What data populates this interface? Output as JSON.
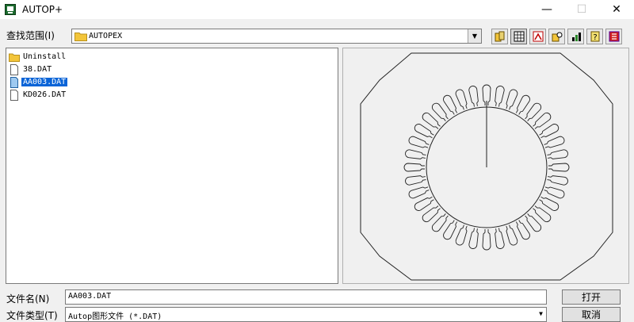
{
  "window": {
    "title": "AUTOP+",
    "minimize_symbol": "—",
    "maximize_symbol": "☐",
    "close_symbol": "✕"
  },
  "lookin": {
    "label": "查找范围(I)",
    "value": "AUTOPEX",
    "icon": "folder-icon"
  },
  "toolbar": {
    "buttons": [
      "folder-open-icon",
      "grid-icon",
      "chart-icon",
      "search-folder-icon",
      "bars-icon",
      "help-icon",
      "exit-icon"
    ]
  },
  "files": [
    {
      "name": "Uninstall",
      "type": "folder",
      "selected": false
    },
    {
      "name": "38.DAT",
      "type": "file",
      "selected": false
    },
    {
      "name": "AA003.DAT",
      "type": "file",
      "selected": true
    },
    {
      "name": "KD026.DAT",
      "type": "file",
      "selected": false
    }
  ],
  "preview": {
    "description_icon": "stator-lamination-icon",
    "slot_count": 36
  },
  "filename": {
    "label": "文件名(N)",
    "value": "AA003.DAT"
  },
  "filetype": {
    "label": "文件类型(T)",
    "value": "Autop图形文件 (*.DAT)"
  },
  "buttons": {
    "open": "打开",
    "cancel": "取消"
  },
  "colors": {
    "selection": "#0a64d7",
    "titlebar": "#ffffff",
    "window_bg": "#f0f0f0"
  }
}
